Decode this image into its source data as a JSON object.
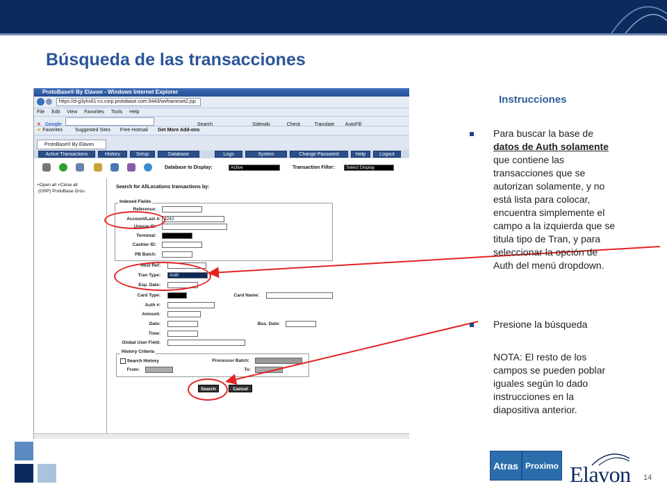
{
  "slide": {
    "title": "Búsqueda de las transacciones",
    "page_number": "14"
  },
  "browser": {
    "window_title": "ProtoBase® By Elavon - Windows Internet Explorer",
    "url": "https://d-g3yhs61-cs.corp.protobase.com:9443/wvframeset2.jsp",
    "search_engine": "Google",
    "menu": [
      "File",
      "Edit",
      "View",
      "Favorites",
      "Tools",
      "Help"
    ],
    "toolbar": [
      "Search",
      "Sidewiki",
      "Check",
      "Translate",
      "AutoFill"
    ],
    "favorites_bar": [
      "Favorites",
      "Suggested Sites",
      "Free Hotmail",
      "Get More Add-ons"
    ],
    "tab": "ProtoBase® By Elavon"
  },
  "app": {
    "nav": [
      "Active Transactions",
      "History",
      "Setup",
      "Database",
      "Logs",
      "System",
      "Change Password",
      "Help",
      "Logout"
    ],
    "db_label": "Database to Display:",
    "db_value": "Active",
    "filter_label": "Transaction Filter:",
    "filter_value": "Select Display",
    "tree_open": "+Open all",
    "tree_close": "+Close all",
    "tree_item": "(GRP) ProtoBase Grou",
    "search_heading": "Search for AllLocations transactions by:",
    "indexed_legend": "Indexed Fields",
    "fields": {
      "reference": "Reference:",
      "account": "Account/Last 4:",
      "account_value": "4242",
      "unique_id": "Unique ID:",
      "terminal": "Terminal:",
      "cashier": "Cashier ID:",
      "pb_batch": "PB Batch:",
      "host_ref": "Host Ref:",
      "tran_type": "Tran Type:",
      "tran_type_value": "Auth",
      "exp_date": "Exp. Date:",
      "card_type": "Card Type:",
      "card_name": "Card Name:",
      "auth": "Auth #:",
      "amount": "Amount:",
      "date": "Date:",
      "bus_date": "Bus. Date:",
      "time": "Time:",
      "global_user": "Global User Field:"
    },
    "history_legend": "History Criteria",
    "search_history": "Search History",
    "processor_batch": "Processor Batch:",
    "from": "From:",
    "to": "To:",
    "search_btn": "Search",
    "cancel_btn": "Cancel"
  },
  "instructions": {
    "heading": "Instrucciones",
    "b1_pre": "Para buscar la base de ",
    "b1_em": "datos de Auth solamente ",
    "b1_post": "que contiene las transacciones que se autorizan solamente, y no está lista para colocar, encuentra simplemente el campo a la izquierda que se titula tipo de Tran, y para seleccionar la opción de Auth del menú dropdown.",
    "b2": "Presione la búsqueda",
    "note": "NOTA: El resto de los campos se pueden poblar iguales según lo dado instrucciones en la diapositiva anterior."
  },
  "nav_buttons": {
    "back": "Atras",
    "next": "Proximo"
  },
  "logo_text": "Elavon",
  "colors": {
    "brand_navy": "#0d2a5c",
    "title_blue": "#2a5599",
    "highlight_red": "#e32222"
  }
}
